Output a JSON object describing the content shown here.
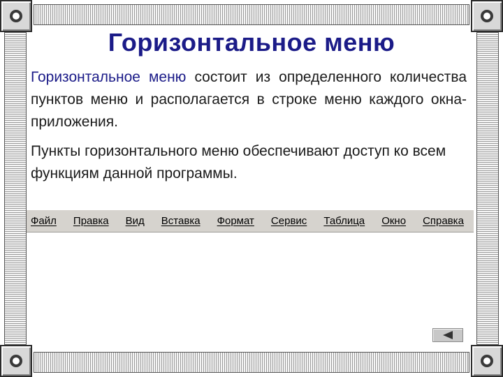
{
  "title": "Горизонтальное меню",
  "paragraph1": {
    "accent": "Горизонтальное меню",
    "rest": " состоит из определенного количества пунктов меню и располагается в строке меню каждого окна-приложения."
  },
  "paragraph2": "Пункты горизонтального меню обеспечивают доступ ко всем функциям данной программы.",
  "menu": {
    "items": [
      "Файл",
      "Правка",
      "Вид",
      "Вставка",
      "Формат",
      "Сервис",
      "Таблица",
      "Окно",
      "Справка"
    ]
  },
  "colors": {
    "title": "#1b1b88",
    "menu_bar": "#d6d3ce"
  },
  "icons": {
    "nav_back": "left-triangle-icon",
    "corners": "circle-knob-icon"
  }
}
